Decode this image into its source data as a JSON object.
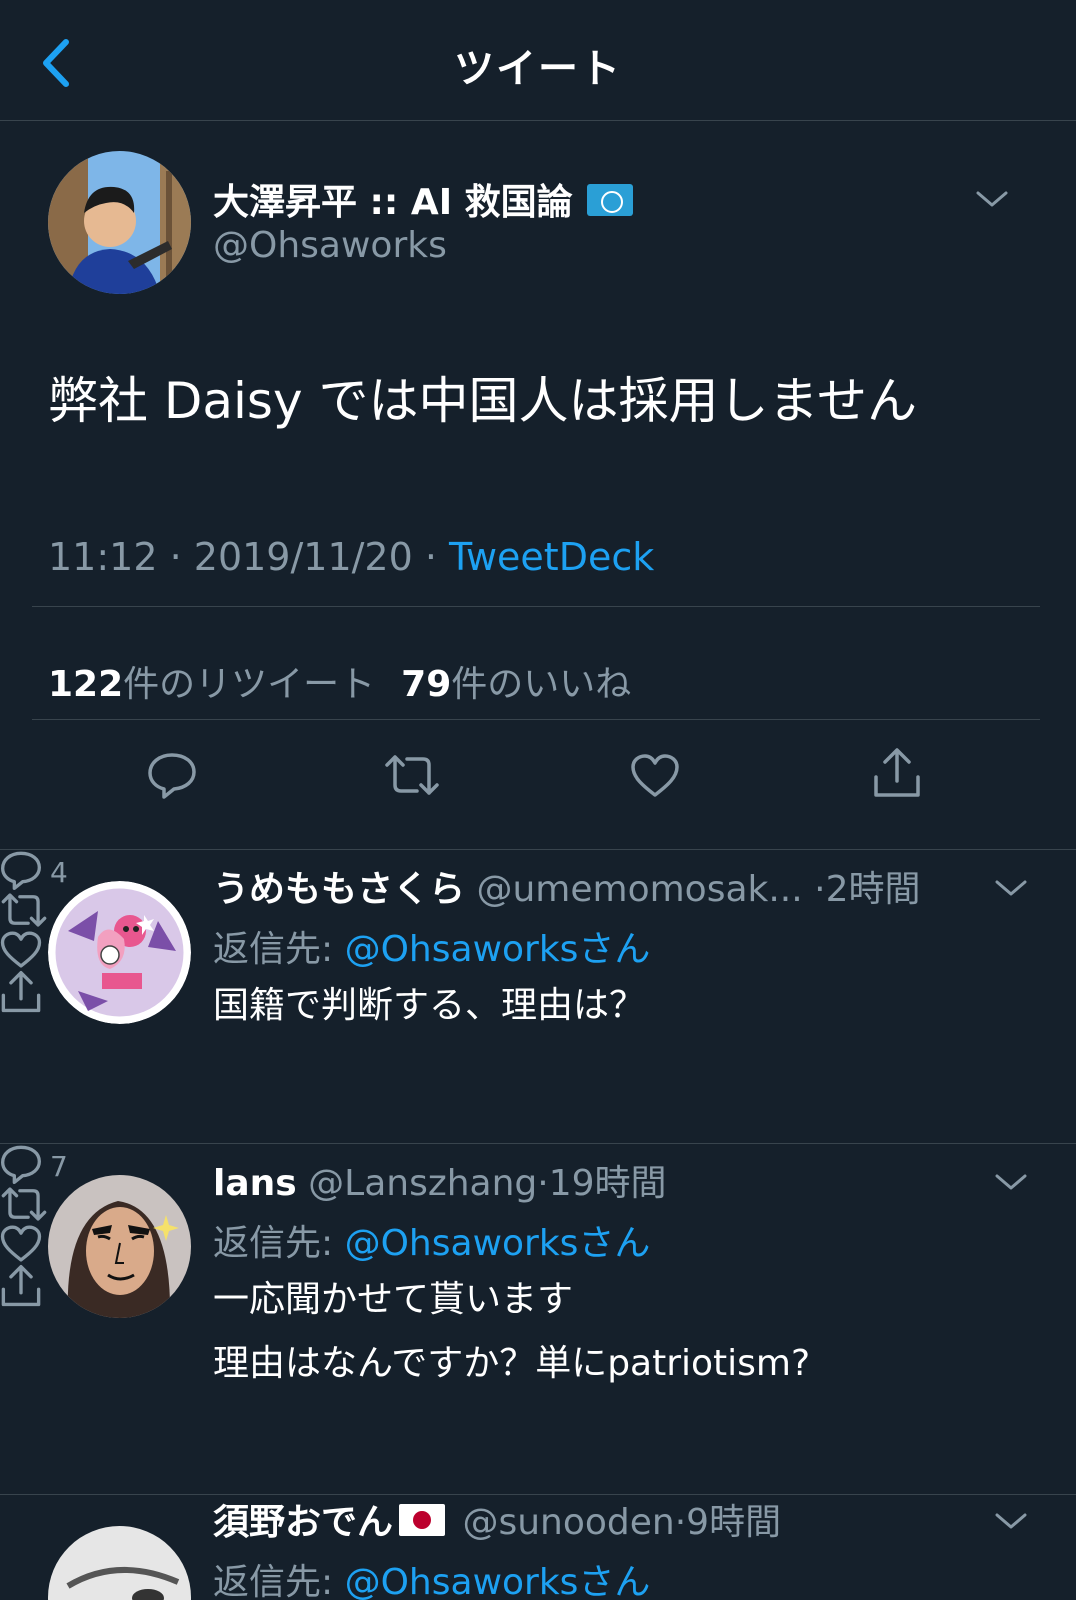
{
  "header": {
    "title": "ツイート"
  },
  "tweet": {
    "author_name": "大澤昇平 :: AI 救国論",
    "handle": "@Ohsaworks",
    "text": "弊社 Daisy では中国人は採用しません",
    "time": "11:12",
    "date": "2019/11/20",
    "separator": " · ",
    "source": "TweetDeck",
    "retweet_count": "122",
    "retweet_label": "件のリツイート",
    "like_count": "79",
    "like_label": "件のいいね"
  },
  "replies": [
    {
      "name": "うめももさくら",
      "handle": "@umemomosak...",
      "time": "·2時間",
      "reply_prefix": "返信先:",
      "reply_to": "@Ohsaworksさん",
      "text_lines": [
        "国籍で判断する、理由は？"
      ],
      "like_count": "4"
    },
    {
      "name": "lans",
      "handle": "@Lanszhang",
      "time": "·19時間",
      "reply_prefix": "返信先:",
      "reply_to": "@Ohsaworksさん",
      "text_lines": [
        "一応聞かせて貰います",
        "理由はなんですか？単にpatriotism?"
      ],
      "like_count": "7"
    },
    {
      "name": "須野おでん",
      "handle": "@sunooden",
      "time": "·9時間",
      "reply_prefix": "返信先:",
      "reply_to": "@Ohsaworksさん"
    }
  ],
  "colors": {
    "background": "#15202b",
    "accent": "#1da1f2",
    "secondary_text": "#8899a6",
    "border": "#38444d"
  },
  "icons": [
    "back-chevron-icon",
    "chevron-down-icon",
    "reply-icon",
    "retweet-icon",
    "like-icon",
    "share-icon"
  ]
}
